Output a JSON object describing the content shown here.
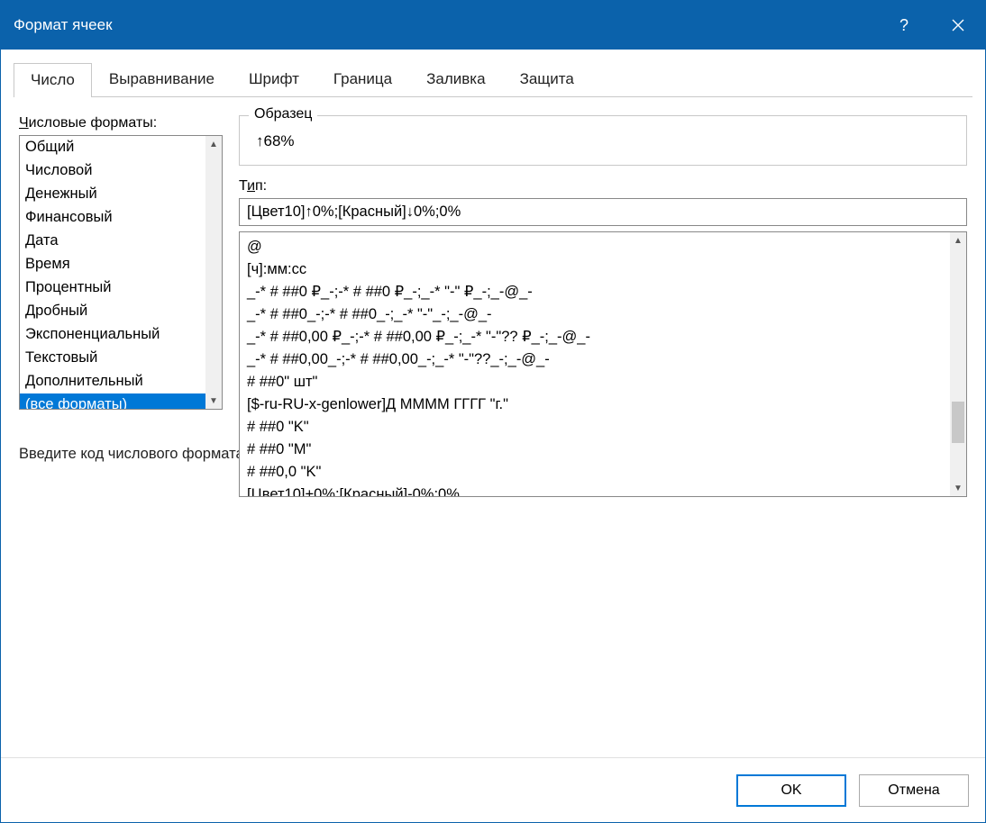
{
  "title": "Формат ячеек",
  "tabs": [
    "Число",
    "Выравнивание",
    "Шрифт",
    "Граница",
    "Заливка",
    "Защита"
  ],
  "activeTab": 0,
  "labels": {
    "numberFormats": "Числовые форматы:",
    "sample": "Образец",
    "type": "Тип:",
    "hint": "Введите код числового формата, используя один из существующих кодов в качестве образца."
  },
  "categories": [
    "Общий",
    "Числовой",
    "Денежный",
    "Финансовый",
    "Дата",
    "Время",
    "Процентный",
    "Дробный",
    "Экспоненциальный",
    "Текстовый",
    "Дополнительный",
    "(все форматы)"
  ],
  "selectedCategoryIndex": 11,
  "sampleValue": "↑68%",
  "typeValue": "[Цвет10]↑0%;[Красный]↓0%;0%",
  "formatCodes": [
    "@",
    "[ч]:мм:сс",
    "_-* # ##0 ₽_-;-* # ##0 ₽_-;_-* \"-\" ₽_-;_-@_-",
    "_-* # ##0_-;-* # ##0_-;_-* \"-\"_-;_-@_-",
    "_-* # ##0,00 ₽_-;-* # ##0,00 ₽_-;_-* \"-\"?? ₽_-;_-@_-",
    "_-* # ##0,00_-;-* # ##0,00_-;_-* \"-\"??_-;_-@_-",
    "# ##0\" шт\"",
    "[$-ru-RU-x-genlower]Д ММММ ГГГГ \"г.\"",
    "# ##0 \"K\"",
    "# ##0  \"M\"",
    "# ##0,0 \"K\"",
    "[Цвет10]+0%;[Красный]-0%;0%"
  ],
  "buttons": {
    "ok": "OK",
    "cancel": "Отмена"
  }
}
